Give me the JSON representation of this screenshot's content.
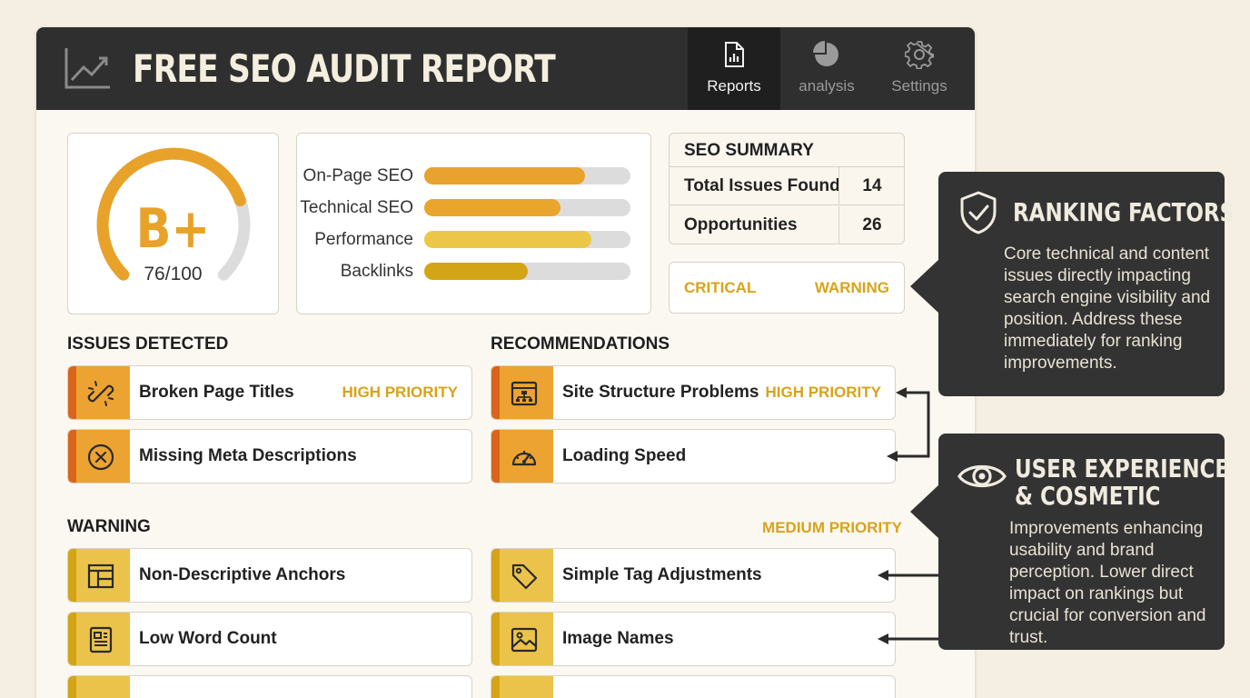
{
  "header": {
    "title": "FREE SEO AUDIT REPORT",
    "logo_icon": "line-chart-icon",
    "tabs": [
      {
        "label": "Reports",
        "icon": "document-chart-icon",
        "active": true
      },
      {
        "label": "analysis",
        "icon": "pie-chart-icon",
        "active": false
      },
      {
        "label": "Settings",
        "icon": "gear-icon",
        "active": false
      }
    ]
  },
  "grade": {
    "letter": "B+",
    "score_text": "76/100",
    "score": 76,
    "max": 100
  },
  "categories": [
    {
      "label": "On-Page SEO",
      "fill": 0.78,
      "color": "#eaa22e"
    },
    {
      "label": "Technical SEO",
      "fill": 0.66,
      "color": "#e9a52c"
    },
    {
      "label": "Performance",
      "fill": 0.81,
      "color": "#ecc646"
    },
    {
      "label": "Backlinks",
      "fill": 0.5,
      "color": "#d4a417"
    }
  ],
  "summary": {
    "title": "SEO SUMMARY",
    "rows": [
      {
        "label": "Total Issues Found",
        "value": "14"
      },
      {
        "label": "Opportunities",
        "value": "26"
      }
    ]
  },
  "severity": {
    "critical": "CRITICAL",
    "warning": "WARNING"
  },
  "sections": {
    "issues": "ISSUES DETECTED",
    "recommendations": "RECOMMENDATIONS",
    "warning": "WARNING",
    "medium_priority": "MEDIUM PRIORITY"
  },
  "items": {
    "broken_titles": {
      "label": "Broken Page Titles",
      "priority": "HIGH PRIORITY",
      "icon": "broken-link-icon"
    },
    "missing_meta": {
      "label": "Missing Meta Descriptions",
      "icon": "x-circle-icon"
    },
    "site_structure": {
      "label": "Site Structure Problems",
      "priority": "HIGH PRIORITY",
      "icon": "sitemap-icon"
    },
    "loading_speed": {
      "label": "Loading Speed",
      "icon": "speedometer-icon"
    },
    "anchors": {
      "label": "Non-Descriptive Anchors",
      "icon": "layout-icon"
    },
    "word_count": {
      "label": "Low Word Count",
      "icon": "text-document-icon"
    },
    "tag_adjust": {
      "label": "Simple Tag Adjustments",
      "icon": "tag-icon"
    },
    "image_names": {
      "label": "Image Names",
      "icon": "image-icon"
    }
  },
  "callouts": {
    "ranking": {
      "title": "RANKING FACTORS",
      "icon": "shield-check-icon",
      "body": "Core technical and content issues directly impacting search engine visibility and position. Address these immediately for ranking improvements."
    },
    "ux": {
      "title_line1": "USER EXPERIENCE",
      "title_line2": "& COSMETIC",
      "icon": "eye-icon",
      "body": "Improvements enhancing usability and brand perception. Lower direct impact on rankings but crucial for conversion and trust."
    }
  },
  "colors": {
    "accent": "#e8a22a",
    "dark": "#2f2f2f",
    "priority": "#d8a31a",
    "critical_strip": "#d9651b"
  }
}
